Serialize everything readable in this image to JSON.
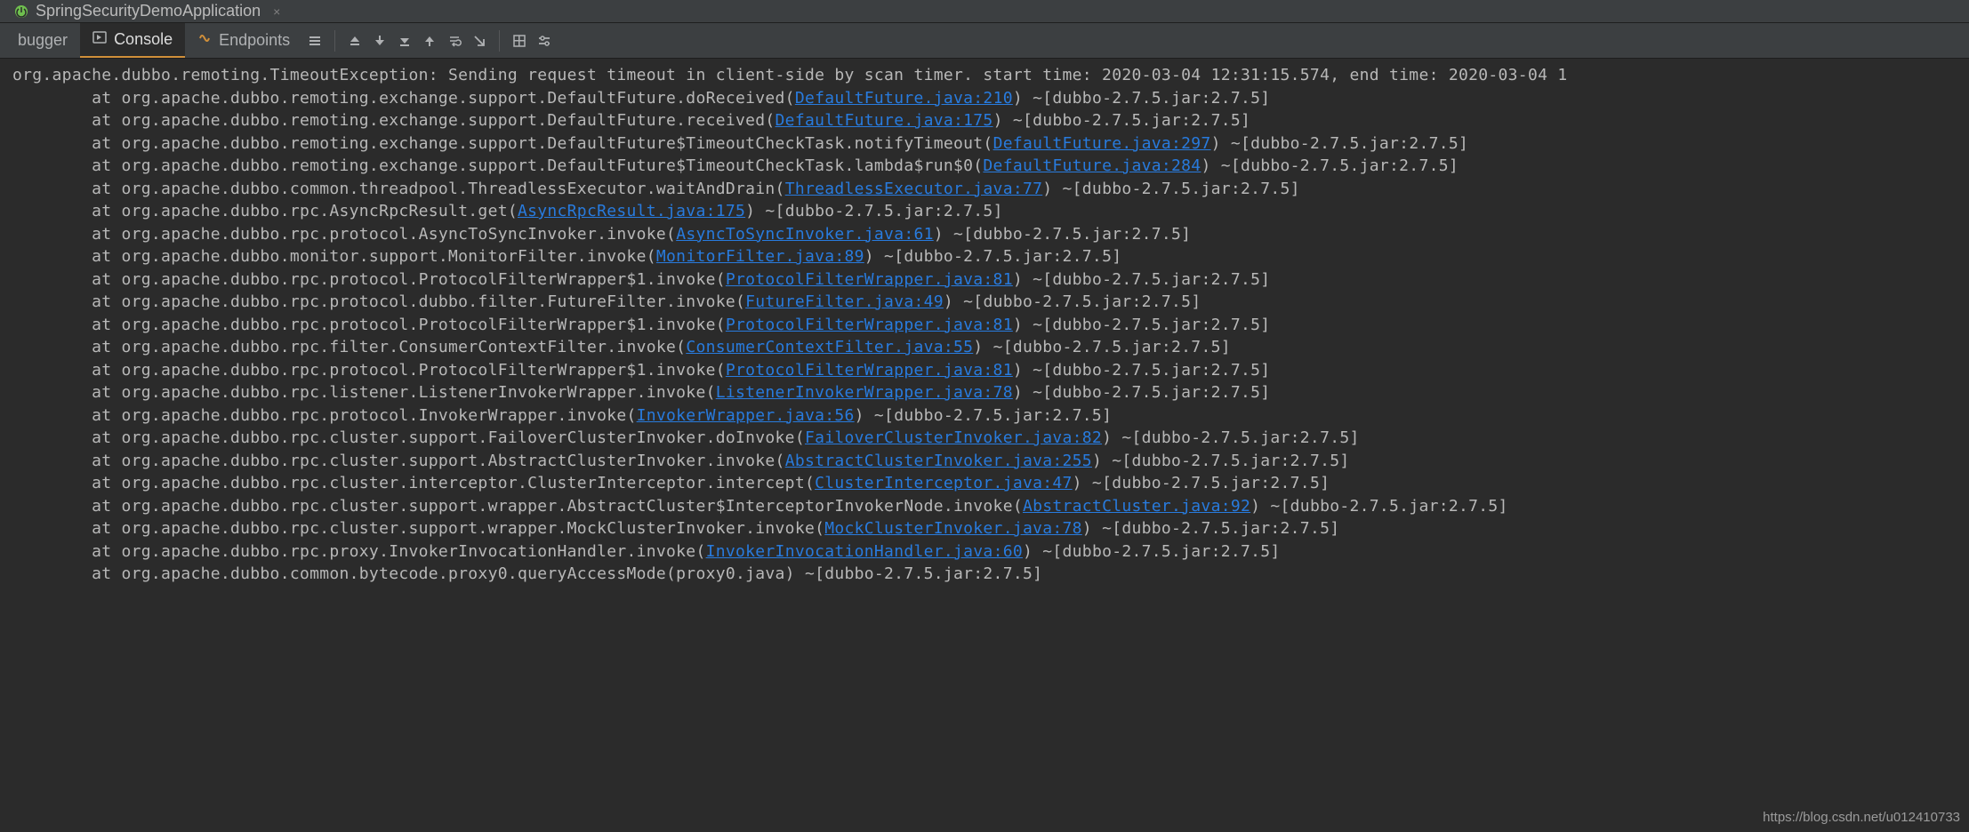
{
  "fileTab": {
    "name": "SpringSecurityDemoApplication"
  },
  "toolTabs": {
    "debugger": "bugger",
    "console": "Console",
    "endpoints": "Endpoints"
  },
  "exceptionLine": "org.apache.dubbo.remoting.TimeoutException: Sending request timeout in client-side by scan timer. start time: 2020-03-04 12:31:15.574, end time: 2020-03-04 1",
  "stack": [
    {
      "pre": "        at org.apache.dubbo.remoting.exchange.support.DefaultFuture.doReceived(",
      "link": "DefaultFuture.java:210",
      "post": ") ~[dubbo-2.7.5.jar:2.7.5]"
    },
    {
      "pre": "        at org.apache.dubbo.remoting.exchange.support.DefaultFuture.received(",
      "link": "DefaultFuture.java:175",
      "post": ") ~[dubbo-2.7.5.jar:2.7.5]"
    },
    {
      "pre": "        at org.apache.dubbo.remoting.exchange.support.DefaultFuture$TimeoutCheckTask.notifyTimeout(",
      "link": "DefaultFuture.java:297",
      "post": ") ~[dubbo-2.7.5.jar:2.7.5]"
    },
    {
      "pre": "        at org.apache.dubbo.remoting.exchange.support.DefaultFuture$TimeoutCheckTask.lambda$run$0(",
      "link": "DefaultFuture.java:284",
      "post": ") ~[dubbo-2.7.5.jar:2.7.5]"
    },
    {
      "pre": "        at org.apache.dubbo.common.threadpool.ThreadlessExecutor.waitAndDrain(",
      "link": "ThreadlessExecutor.java:77",
      "post": ") ~[dubbo-2.7.5.jar:2.7.5]"
    },
    {
      "pre": "        at org.apache.dubbo.rpc.AsyncRpcResult.get(",
      "link": "AsyncRpcResult.java:175",
      "post": ") ~[dubbo-2.7.5.jar:2.7.5]"
    },
    {
      "pre": "        at org.apache.dubbo.rpc.protocol.AsyncToSyncInvoker.invoke(",
      "link": "AsyncToSyncInvoker.java:61",
      "post": ") ~[dubbo-2.7.5.jar:2.7.5]"
    },
    {
      "pre": "        at org.apache.dubbo.monitor.support.MonitorFilter.invoke(",
      "link": "MonitorFilter.java:89",
      "post": ") ~[dubbo-2.7.5.jar:2.7.5]"
    },
    {
      "pre": "        at org.apache.dubbo.rpc.protocol.ProtocolFilterWrapper$1.invoke(",
      "link": "ProtocolFilterWrapper.java:81",
      "post": ") ~[dubbo-2.7.5.jar:2.7.5]"
    },
    {
      "pre": "        at org.apache.dubbo.rpc.protocol.dubbo.filter.FutureFilter.invoke(",
      "link": "FutureFilter.java:49",
      "post": ") ~[dubbo-2.7.5.jar:2.7.5]"
    },
    {
      "pre": "        at org.apache.dubbo.rpc.protocol.ProtocolFilterWrapper$1.invoke(",
      "link": "ProtocolFilterWrapper.java:81",
      "post": ") ~[dubbo-2.7.5.jar:2.7.5]"
    },
    {
      "pre": "        at org.apache.dubbo.rpc.filter.ConsumerContextFilter.invoke(",
      "link": "ConsumerContextFilter.java:55",
      "post": ") ~[dubbo-2.7.5.jar:2.7.5]"
    },
    {
      "pre": "        at org.apache.dubbo.rpc.protocol.ProtocolFilterWrapper$1.invoke(",
      "link": "ProtocolFilterWrapper.java:81",
      "post": ") ~[dubbo-2.7.5.jar:2.7.5]"
    },
    {
      "pre": "        at org.apache.dubbo.rpc.listener.ListenerInvokerWrapper.invoke(",
      "link": "ListenerInvokerWrapper.java:78",
      "post": ") ~[dubbo-2.7.5.jar:2.7.5]"
    },
    {
      "pre": "        at org.apache.dubbo.rpc.protocol.InvokerWrapper.invoke(",
      "link": "InvokerWrapper.java:56",
      "post": ") ~[dubbo-2.7.5.jar:2.7.5]"
    },
    {
      "pre": "        at org.apache.dubbo.rpc.cluster.support.FailoverClusterInvoker.doInvoke(",
      "link": "FailoverClusterInvoker.java:82",
      "post": ") ~[dubbo-2.7.5.jar:2.7.5]"
    },
    {
      "pre": "        at org.apache.dubbo.rpc.cluster.support.AbstractClusterInvoker.invoke(",
      "link": "AbstractClusterInvoker.java:255",
      "post": ") ~[dubbo-2.7.5.jar:2.7.5]"
    },
    {
      "pre": "        at org.apache.dubbo.rpc.cluster.interceptor.ClusterInterceptor.intercept(",
      "link": "ClusterInterceptor.java:47",
      "post": ") ~[dubbo-2.7.5.jar:2.7.5]"
    },
    {
      "pre": "        at org.apache.dubbo.rpc.cluster.support.wrapper.AbstractCluster$InterceptorInvokerNode.invoke(",
      "link": "AbstractCluster.java:92",
      "post": ") ~[dubbo-2.7.5.jar:2.7.5]"
    },
    {
      "pre": "        at org.apache.dubbo.rpc.cluster.support.wrapper.MockClusterInvoker.invoke(",
      "link": "MockClusterInvoker.java:78",
      "post": ") ~[dubbo-2.7.5.jar:2.7.5]"
    },
    {
      "pre": "        at org.apache.dubbo.rpc.proxy.InvokerInvocationHandler.invoke(",
      "link": "InvokerInvocationHandler.java:60",
      "post": ") ~[dubbo-2.7.5.jar:2.7.5]"
    },
    {
      "pre": "        at org.apache.dubbo.common.bytecode.proxy0.queryAccessMode(proxy0.java) ~[dubbo-2.7.5.jar:2.7.5]",
      "link": "",
      "post": ""
    }
  ],
  "watermark": "https://blog.csdn.net/u012410733"
}
